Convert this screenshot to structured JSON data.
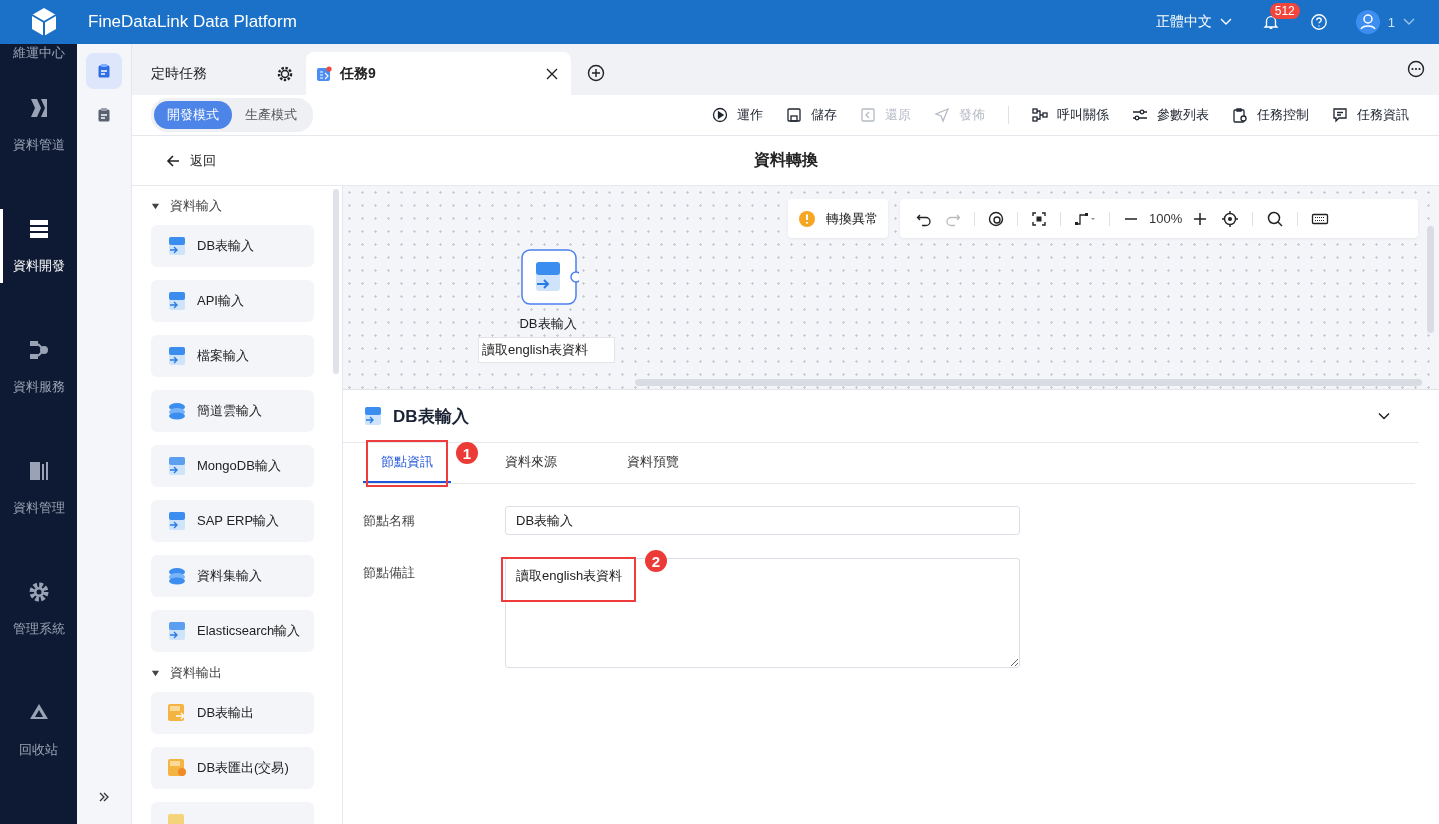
{
  "header": {
    "title": "FineDataLink Data Platform",
    "language": "正體中文",
    "notifications": "512",
    "user": "1"
  },
  "nav": [
    {
      "label": "維運中心",
      "kind": "none",
      "selected": false
    },
    {
      "label": "資料管道",
      "kind": "pipe",
      "selected": false
    },
    {
      "label": "資料開發",
      "kind": "dev",
      "selected": true
    },
    {
      "label": "資料服務",
      "kind": "service",
      "selected": false
    },
    {
      "label": "資料管理",
      "kind": "manage",
      "selected": false
    },
    {
      "label": "管理系統",
      "kind": "gear",
      "selected": false
    },
    {
      "label": "回收站",
      "kind": "trash",
      "selected": false
    }
  ],
  "subnav": [
    {
      "selected": true
    },
    {
      "selected": false
    }
  ],
  "tabs": [
    {
      "label": "定時任務",
      "kind": "settings",
      "selected": false
    },
    {
      "label": "任務9",
      "kind": "task",
      "selected": true
    }
  ],
  "modes": [
    {
      "label": "開發模式",
      "selected": true
    },
    {
      "label": "生產模式",
      "selected": false
    }
  ],
  "actions": [
    {
      "label": "運作",
      "kind": "play",
      "disabled": false
    },
    {
      "label": "儲存",
      "kind": "save",
      "disabled": false
    },
    {
      "label": "還原",
      "kind": "revert",
      "disabled": true
    },
    {
      "label": "發佈",
      "kind": "send",
      "disabled": true
    },
    {
      "label": "呼叫關係",
      "kind": "relation",
      "disabled": false
    },
    {
      "label": "參數列表",
      "kind": "params",
      "disabled": false
    },
    {
      "label": "任務控制",
      "kind": "control",
      "disabled": false
    },
    {
      "label": "任務資訊",
      "kind": "info",
      "disabled": false
    }
  ],
  "back": "返回",
  "page_title": "資料轉換",
  "palette": [
    {
      "group": "資料輸入",
      "expanded": true,
      "items": [
        {
          "label": "DB表輸入",
          "kind": "db"
        },
        {
          "label": "API輸入",
          "kind": "api"
        },
        {
          "label": "檔案輸入",
          "kind": "file"
        },
        {
          "label": "簡道雲輸入",
          "kind": "cloud"
        },
        {
          "label": "MongoDB輸入",
          "kind": "mongo"
        },
        {
          "label": "SAP ERP輸入",
          "kind": "sap"
        },
        {
          "label": "資料集輸入",
          "kind": "dataset"
        },
        {
          "label": "Elasticsearch輸入",
          "kind": "elastic"
        }
      ]
    },
    {
      "group": "資料輸出",
      "expanded": true,
      "items": [
        {
          "label": "DB表輸出",
          "kind": "db-out"
        },
        {
          "label": "DB表匯出(交易)",
          "kind": "db-tx"
        }
      ]
    }
  ],
  "canvas": {
    "warning": "轉換異常",
    "zoom": "100%",
    "node": {
      "label": "DB表輸入",
      "note": "讀取english表資料"
    }
  },
  "detail": {
    "title": "DB表輸入",
    "tabs": [
      {
        "label": "節點資訊",
        "selected": true
      },
      {
        "label": "資料來源",
        "selected": false
      },
      {
        "label": "資料預覽",
        "selected": false
      }
    ],
    "fields": [
      {
        "label": "節點名稱",
        "kind": "input",
        "value": "DB表輸入"
      },
      {
        "label": "節點備註",
        "kind": "textarea",
        "value": "讀取english表資料"
      }
    ]
  },
  "annotations": [
    "1",
    "2"
  ]
}
